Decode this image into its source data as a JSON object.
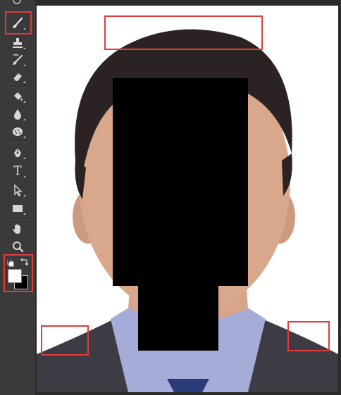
{
  "toolbar": {
    "tools": [
      {
        "name": "brush-tool",
        "icon": "brush-icon",
        "active": true
      },
      {
        "name": "clone-stamp-tool",
        "icon": "stamp-icon"
      },
      {
        "name": "history-brush-tool",
        "icon": "history-brush-icon"
      },
      {
        "name": "eraser-tool",
        "icon": "eraser-icon"
      },
      {
        "name": "paint-bucket-tool",
        "icon": "paint-bucket-icon"
      },
      {
        "name": "blur-tool",
        "icon": "drop-icon"
      },
      {
        "name": "dodge-tool",
        "icon": "dodge-icon"
      },
      {
        "name": "pen-tool",
        "icon": "pen-icon"
      },
      {
        "name": "type-tool",
        "icon": "type-icon",
        "glyph": "T"
      },
      {
        "name": "path-selection-tool",
        "icon": "arrow-icon"
      },
      {
        "name": "rectangle-tool",
        "icon": "rectangle-icon"
      },
      {
        "name": "hand-tool",
        "icon": "hand-icon"
      },
      {
        "name": "zoom-tool",
        "icon": "zoom-icon"
      }
    ],
    "foreground_color": "#ffffff",
    "background_color": "#000000"
  },
  "colors": {
    "highlight": "#e23b3b",
    "panel": "#3a3a3a",
    "canvas_bg": "#ffffff"
  }
}
